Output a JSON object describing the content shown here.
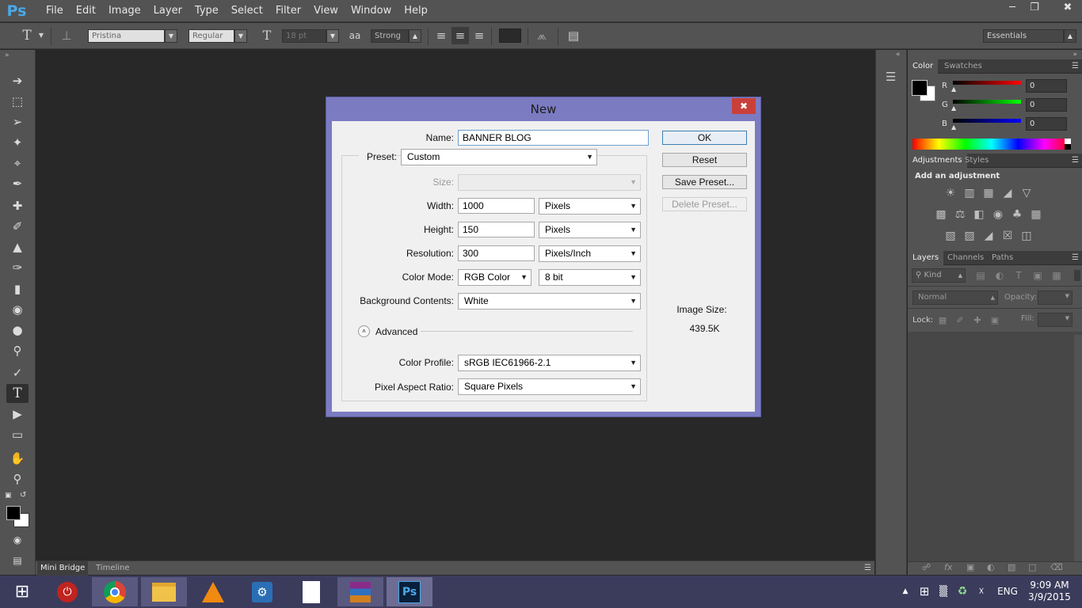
{
  "app": {
    "logo": "Ps"
  },
  "menu": [
    "File",
    "Edit",
    "Image",
    "Layer",
    "Type",
    "Select",
    "Filter",
    "View",
    "Window",
    "Help"
  ],
  "window_controls": {
    "minimize": "minimize-icon",
    "restore": "restore-icon",
    "close": "close-icon"
  },
  "options_bar": {
    "font_family": "Pristina",
    "font_style": "Regular",
    "font_size": "18 pt",
    "aa_label": "aa",
    "antialias": "Strong",
    "workspace": "Essentials"
  },
  "bottom_tabs": [
    "Mini Bridge",
    "Timeline"
  ],
  "color_panel": {
    "tabs": [
      "Color",
      "Swatches"
    ],
    "channels": [
      {
        "label": "R",
        "value": "0",
        "color": "#e02020"
      },
      {
        "label": "G",
        "value": "0",
        "color": "#20c020"
      },
      {
        "label": "B",
        "value": "0",
        "color": "#2020e0"
      }
    ]
  },
  "adjustments_panel": {
    "tabs": [
      "Adjustments",
      "Styles"
    ],
    "heading": "Add an adjustment"
  },
  "layers_panel": {
    "tabs": [
      "Layers",
      "Channels",
      "Paths"
    ],
    "filter_kind": "Kind",
    "blend_mode": "Normal",
    "opacity_label": "Opacity:",
    "lock_label": "Lock:",
    "fill_label": "Fill:"
  },
  "dialog": {
    "title": "New",
    "name_label": "Name:",
    "name_value": "BANNER BLOG",
    "preset_label": "Preset:",
    "preset_value": "Custom",
    "size_label": "Size:",
    "size_value": "",
    "width_label": "Width:",
    "width_value": "1000",
    "width_unit": "Pixels",
    "height_label": "Height:",
    "height_value": "150",
    "height_unit": "Pixels",
    "resolution_label": "Resolution:",
    "resolution_value": "300",
    "resolution_unit": "Pixels/Inch",
    "color_mode_label": "Color Mode:",
    "color_mode_value": "RGB Color",
    "bit_depth": "8 bit",
    "background_label": "Background Contents:",
    "background_value": "White",
    "advanced_label": "Advanced",
    "color_profile_label": "Color Profile:",
    "color_profile_value": "sRGB IEC61966-2.1",
    "pixel_aspect_label": "Pixel Aspect Ratio:",
    "pixel_aspect_value": "Square Pixels",
    "buttons": {
      "ok": "OK",
      "reset": "Reset",
      "save_preset": "Save Preset...",
      "delete_preset": "Delete Preset..."
    },
    "image_size_label": "Image Size:",
    "image_size_value": "439.5K",
    "accent_color": "#7b7bc2"
  },
  "taskbar": {
    "language": "ENG",
    "time": "9:09 AM",
    "date": "3/9/2015",
    "apps": [
      "power-icon",
      "chrome-icon",
      "file-explorer-icon",
      "vlc-icon",
      "settings-app-icon",
      "document-icon",
      "winrar-icon",
      "photoshop-icon"
    ]
  }
}
